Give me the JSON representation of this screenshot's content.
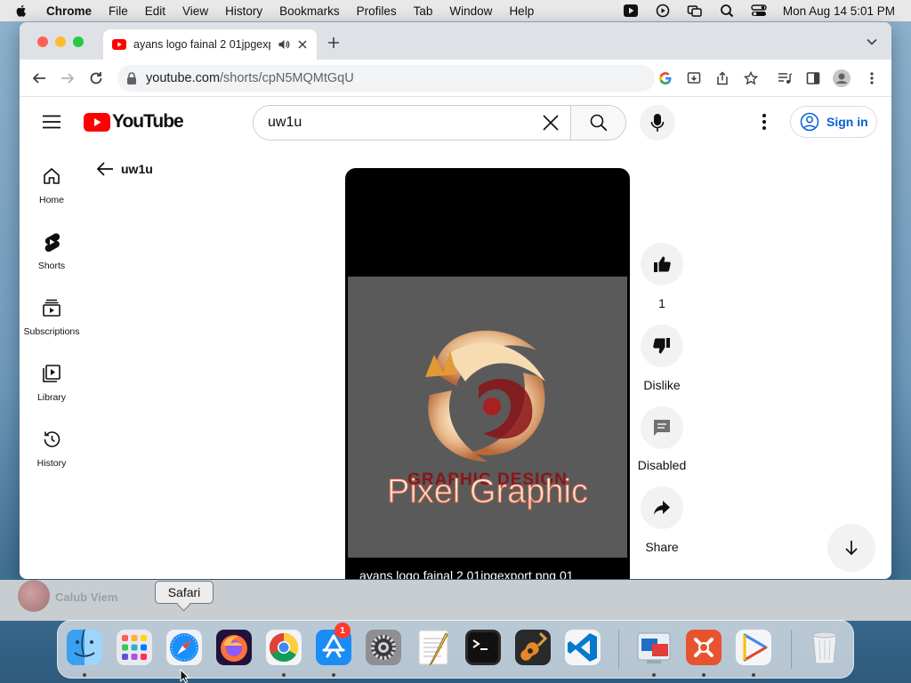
{
  "menubar": {
    "items": [
      "Chrome",
      "File",
      "Edit",
      "View",
      "History",
      "Bookmarks",
      "Profiles",
      "Tab",
      "Window",
      "Help"
    ],
    "clock": "Mon Aug 14  5:01 PM"
  },
  "browser": {
    "tab_title": "ayans logo fainal 2 01jpgexport png 01",
    "url_host": "youtube.com",
    "url_path": "/shorts/cpN5MQMtGqU"
  },
  "youtube": {
    "logo_text": "YouTube",
    "search": {
      "value": "uw1u"
    },
    "signin_label": "Sign in",
    "guide": [
      "Home",
      "Shorts",
      "Subscriptions",
      "Library",
      "History"
    ],
    "back_query": "uw1u",
    "short": {
      "art_text_top": "GRAPHIC DESIGN",
      "art_text_main": "Pixel Graphic",
      "caption": "ayans logo fainal 2 01jpgexport png 01"
    },
    "actions": {
      "like_count": "1",
      "dislike_label": "Dislike",
      "comments_label": "Disabled",
      "share_label": "Share"
    },
    "colors": {
      "brand_red": "#ff0000",
      "link_blue": "#065fd4"
    }
  },
  "background_app": {
    "text": "Calub Viem"
  },
  "dock": {
    "tooltip": "Safari",
    "settings_badge": "1",
    "apps": [
      "Finder",
      "Launchpad",
      "Safari",
      "Firefox",
      "Chrome",
      "App Store",
      "System Settings",
      "TextEdit",
      "Terminal",
      "GarageBand",
      "Visual Studio Code",
      "Remote Desktop",
      "Remote App",
      "Play",
      "Trash"
    ]
  }
}
